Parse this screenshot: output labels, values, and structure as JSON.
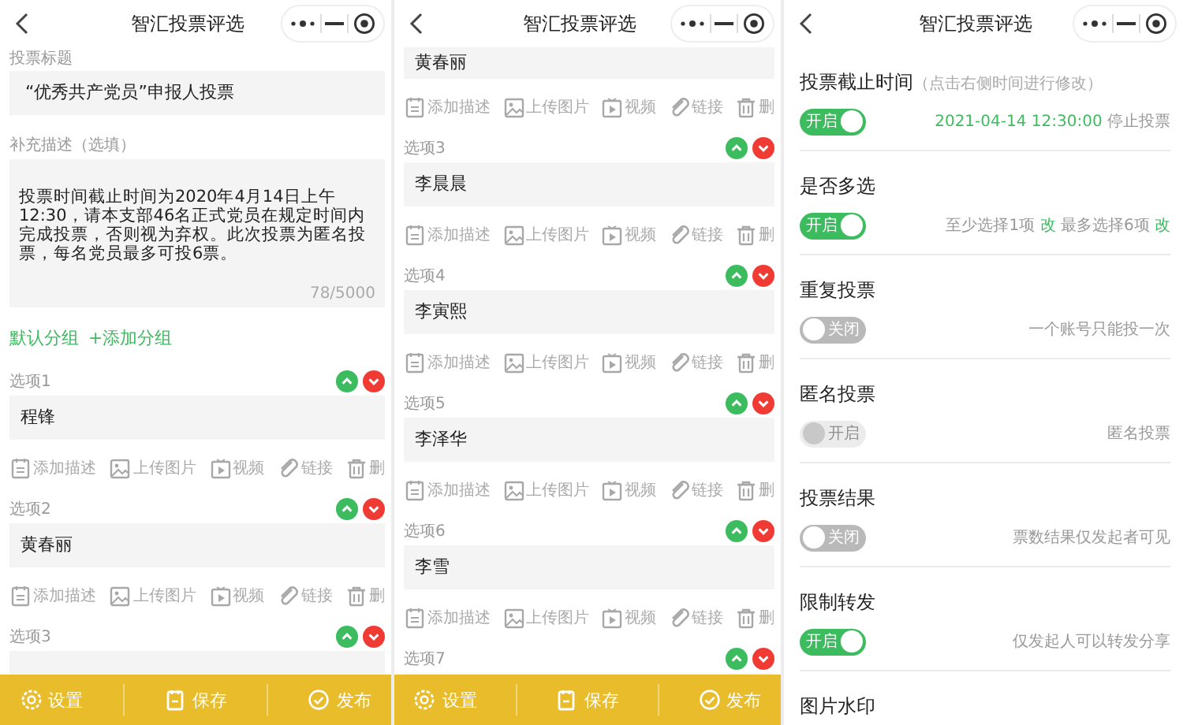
{
  "editor_screen": {
    "header": {
      "title": "智汇投票评选"
    },
    "title_label": "投票标题",
    "title_value": "“优秀共产党员”申报人投票",
    "description_label": "补充描述（选填）",
    "description_value": "投票时间截止时间为2020年4月14日上午12:30，请本支部46名正式党员在规定时间内完成投票，否则视为弃权。此次投票为匿名投票，每名党员最多可投6票。",
    "description_counter": "78/5000",
    "groups": [
      {
        "label": "默认分组"
      },
      {
        "label": "+添加分组"
      }
    ],
    "options": [
      {
        "label": "选项1",
        "name": "程锋",
        "actions": [
          "添加描述",
          "上传图片",
          "视频",
          "链接",
          "删"
        ]
      },
      {
        "label": "选项2",
        "name": "黄春丽",
        "actions": [
          "添加描述",
          "上传图片",
          "视频",
          "链接",
          "删"
        ]
      },
      {
        "label": "选项3"
      }
    ],
    "footer": [
      "设置",
      "保存",
      "发布"
    ]
  },
  "options_screen": {
    "header": {
      "title": "智汇投票评选"
    },
    "options": [
      {
        "name": "黄春丽",
        "partial": true,
        "actions": [
          "添加描述",
          "上传图片",
          "视频",
          "链接",
          "删"
        ]
      },
      {
        "label": "选项3",
        "name": "李晨晨",
        "actions": [
          "添加描述",
          "上传图片",
          "视频",
          "链接",
          "删"
        ]
      },
      {
        "label": "选项4",
        "name": "李寅熙",
        "actions": [
          "添加描述",
          "上传图片",
          "视频",
          "链接",
          "删"
        ]
      },
      {
        "label": "选项5",
        "name": "李泽华",
        "actions": [
          "添加描述",
          "上传图片",
          "视频",
          "链接",
          "删"
        ]
      },
      {
        "label": "选项6",
        "name": "李雪",
        "actions": [
          "添加描述",
          "上传图片",
          "视频",
          "链接",
          "删"
        ]
      },
      {
        "label": "选项7"
      }
    ],
    "footer": [
      "设置",
      "保存",
      "发布"
    ]
  },
  "settings_screen": {
    "header": {
      "title": "智汇投票评选"
    },
    "settings": [
      {
        "title": "投票截止时间",
        "hint": "（点击右侧时间进行修改）",
        "toggle": {
          "label": "开启",
          "on": true,
          "disabled": false
        },
        "detail": [
          {
            "kind": "link",
            "text": "2021-04-14  12:30:00"
          },
          {
            "kind": "text",
            "text": " 停止投票"
          }
        ]
      },
      {
        "title": "是否多选",
        "toggle": {
          "label": "开启",
          "on": true,
          "disabled": false
        },
        "detail": [
          {
            "kind": "text",
            "text": "至少选择1项 "
          },
          {
            "kind": "link",
            "text": "改"
          },
          {
            "kind": "text",
            "text": " 最多选择6项 "
          },
          {
            "kind": "link",
            "text": "改"
          }
        ]
      },
      {
        "title": "重复投票",
        "toggle": {
          "label": "关闭",
          "on": false,
          "disabled": false
        },
        "detail": [
          {
            "kind": "text",
            "text": "一个账号只能投一次"
          }
        ]
      },
      {
        "title": "匿名投票",
        "toggle": {
          "label": "开启",
          "on": false,
          "disabled": true
        },
        "detail": [
          {
            "kind": "text",
            "text": "匿名投票"
          }
        ]
      },
      {
        "title": "投票结果",
        "toggle": {
          "label": "关闭",
          "on": false,
          "disabled": false
        },
        "detail": [
          {
            "kind": "text",
            "text": "票数结果仅发起者可见"
          }
        ]
      },
      {
        "title": "限制转发",
        "toggle": {
          "label": "开启",
          "on": true,
          "disabled": false
        },
        "detail": [
          {
            "kind": "text",
            "text": "仅发起人可以转发分享"
          }
        ]
      },
      {
        "title": "图片水印"
      }
    ]
  }
}
